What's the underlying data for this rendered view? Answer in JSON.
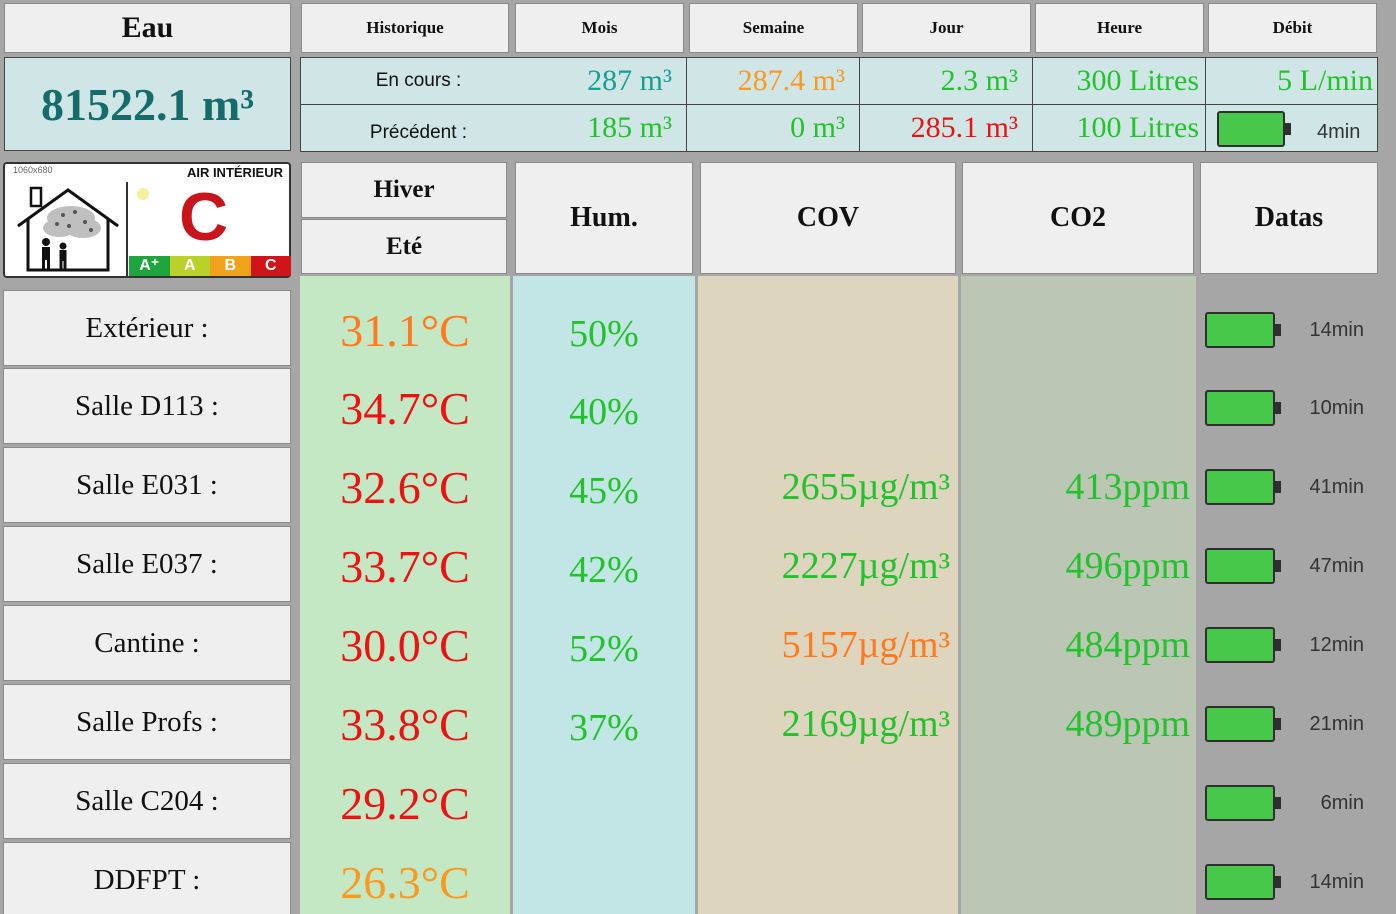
{
  "colors": {
    "green": "#22c32a",
    "teal": "#169d94",
    "orange": "#ff7a1f",
    "amber": "#f79a22",
    "red": "#ee1111",
    "battery": "#47c84a"
  },
  "water": {
    "title": "Eau",
    "total": "81522.1 m³",
    "tabs": [
      "Historique",
      "Mois",
      "Semaine",
      "Jour",
      "Heure",
      "Débit"
    ],
    "current": {
      "label": "En cours :",
      "mois": "287 m³",
      "semaine": "287.4 m³",
      "jour": "2.3 m³",
      "heure": "300 Litres",
      "debit": "5 L/min"
    },
    "previous": {
      "label": "Précédent :",
      "mois": "185 m³",
      "semaine": "0 m³",
      "jour": "285.1 m³",
      "heure": "100 Litres",
      "debit_battery_age": "4min"
    }
  },
  "air_quality": {
    "logo_size": "1060x680",
    "logo_title": "AIR INTÉRIEUR",
    "grade": "C",
    "scale": [
      "A⁺",
      "A",
      "B",
      "C"
    ]
  },
  "headers": {
    "season_winter": "Hiver",
    "season_summer": "Eté",
    "humidity": "Hum.",
    "cov": "COV",
    "co2": "CO2",
    "datas": "Datas"
  },
  "rooms": [
    {
      "name": "Extérieur :",
      "temp": "31.1°C",
      "hum": "50%",
      "cov": "",
      "co2": "",
      "age": "14min"
    },
    {
      "name": "Salle D113 :",
      "temp": "34.7°C",
      "hum": "40%",
      "cov": "",
      "co2": "",
      "age": "10min"
    },
    {
      "name": "Salle E031 :",
      "temp": "32.6°C",
      "hum": "45%",
      "cov": "2655µg/m³",
      "co2": "413ppm",
      "age": "41min"
    },
    {
      "name": "Salle E037 :",
      "temp": "33.7°C",
      "hum": "42%",
      "cov": "2227µg/m³",
      "co2": "496ppm",
      "age": "47min"
    },
    {
      "name": "Cantine :",
      "temp": "30.0°C",
      "hum": "52%",
      "cov": "5157µg/m³",
      "co2": "484ppm",
      "age": "12min"
    },
    {
      "name": "Salle Profs :",
      "temp": "33.8°C",
      "hum": "37%",
      "cov": "2169µg/m³",
      "co2": "489ppm",
      "age": "21min"
    },
    {
      "name": "Salle C204 :",
      "temp": "29.2°C",
      "hum": "",
      "cov": "",
      "co2": "",
      "age": "6min"
    },
    {
      "name": "DDFPT :",
      "temp": "26.3°C",
      "hum": "",
      "cov": "",
      "co2": "",
      "age": "14min"
    }
  ]
}
